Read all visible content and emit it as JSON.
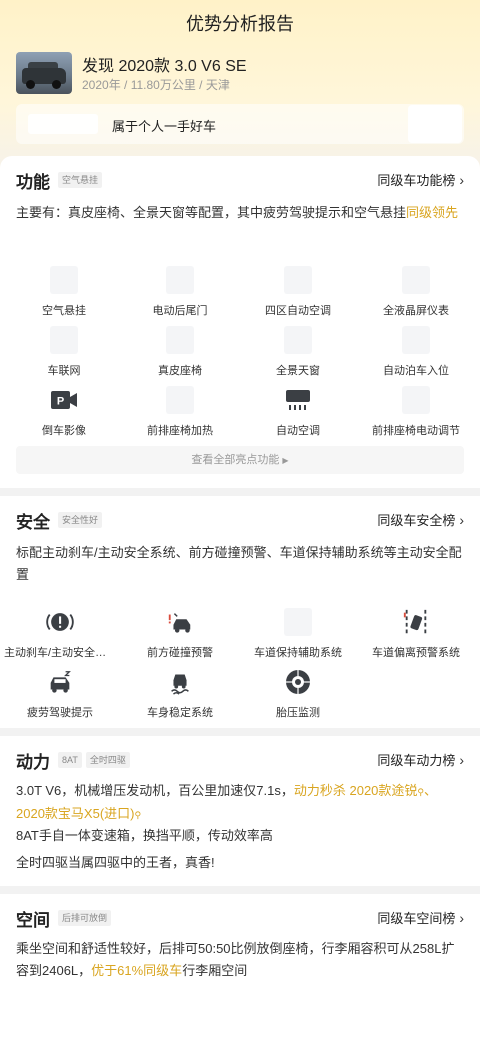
{
  "header": {
    "title": "优势分析报告",
    "car_name": "发现 2020款 3.0 V6 SE",
    "car_meta": "2020年 / 11.80万公里 / 天津",
    "owner_text": "属于个人一手好车"
  },
  "features": {
    "title": "功能",
    "tag": "空气悬挂",
    "rank_label": "同级车功能榜",
    "desc_prefix": "主要有：真皮座椅、全景天窗等配置，其中疲劳驾驶提示和空气悬挂",
    "desc_highlight": "同级领先",
    "items": [
      {
        "label": "空气悬挂",
        "icon": "air-suspension-icon"
      },
      {
        "label": "电动后尾门",
        "icon": "power-tailgate-icon"
      },
      {
        "label": "四区自动空调",
        "icon": "four-zone-ac-icon"
      },
      {
        "label": "全液晶屏仪表",
        "icon": "lcd-cluster-icon"
      },
      {
        "label": "车联网",
        "icon": "connected-car-icon"
      },
      {
        "label": "真皮座椅",
        "icon": "leather-seat-icon"
      },
      {
        "label": "全景天窗",
        "icon": "panoramic-sunroof-icon"
      },
      {
        "label": "自动泊车入位",
        "icon": "auto-park-icon"
      },
      {
        "label": "倒车影像",
        "icon": "reverse-camera-icon"
      },
      {
        "label": "前排座椅加热",
        "icon": "seat-heating-icon"
      },
      {
        "label": "自动空调",
        "icon": "auto-ac-icon"
      },
      {
        "label": "前排座椅电动调节",
        "icon": "power-seat-icon"
      }
    ],
    "view_all": "查看全部亮点功能"
  },
  "safety": {
    "title": "安全",
    "tag": "安全性好",
    "rank_label": "同级车安全榜",
    "desc": "标配主动刹车/主动安全系统、前方碰撞预警、车道保持辅助系统等主动安全配置",
    "items": [
      {
        "label": "主动刹车/主动安全系统",
        "icon": "active-brake-icon"
      },
      {
        "label": "前方碰撞预警",
        "icon": "collision-warning-icon"
      },
      {
        "label": "车道保持辅助系统",
        "icon": "lane-keep-icon"
      },
      {
        "label": "车道偏离预警系统",
        "icon": "lane-departure-icon"
      },
      {
        "label": "疲劳驾驶提示",
        "icon": "fatigue-alert-icon"
      },
      {
        "label": "车身稳定系统",
        "icon": "stability-control-icon"
      },
      {
        "label": "胎压监测",
        "icon": "tire-pressure-icon"
      }
    ]
  },
  "power": {
    "title": "动力",
    "tags": [
      "8AT",
      "全时四驱"
    ],
    "rank_label": "同级车动力榜",
    "line1_prefix": "3.0T V6，机械增压发动机，百公里加速仅7.1s，",
    "line1_highlight_a": "动力秒杀 2020款途锐",
    "line1_sep": "、",
    "line1_highlight_b": "2020款宝马X5(进口)",
    "line2": "8AT手自一体变速箱，换挡平顺，传动效率高",
    "line3": "全时四驱当属四驱中的王者，真香!"
  },
  "space": {
    "title": "空间",
    "tag": "后排可放倒",
    "rank_label": "同级车空间榜",
    "desc_prefix": "乘坐空间和舒适性较好，后排可50:50比例放倒座椅，行李厢容积可从258L扩容到2406L，",
    "desc_highlight": "优于61%同级车",
    "desc_suffix": "行李厢空间"
  },
  "colors": {
    "highlight": "#d9a520",
    "header_gradient_top": "#fff2c8"
  }
}
